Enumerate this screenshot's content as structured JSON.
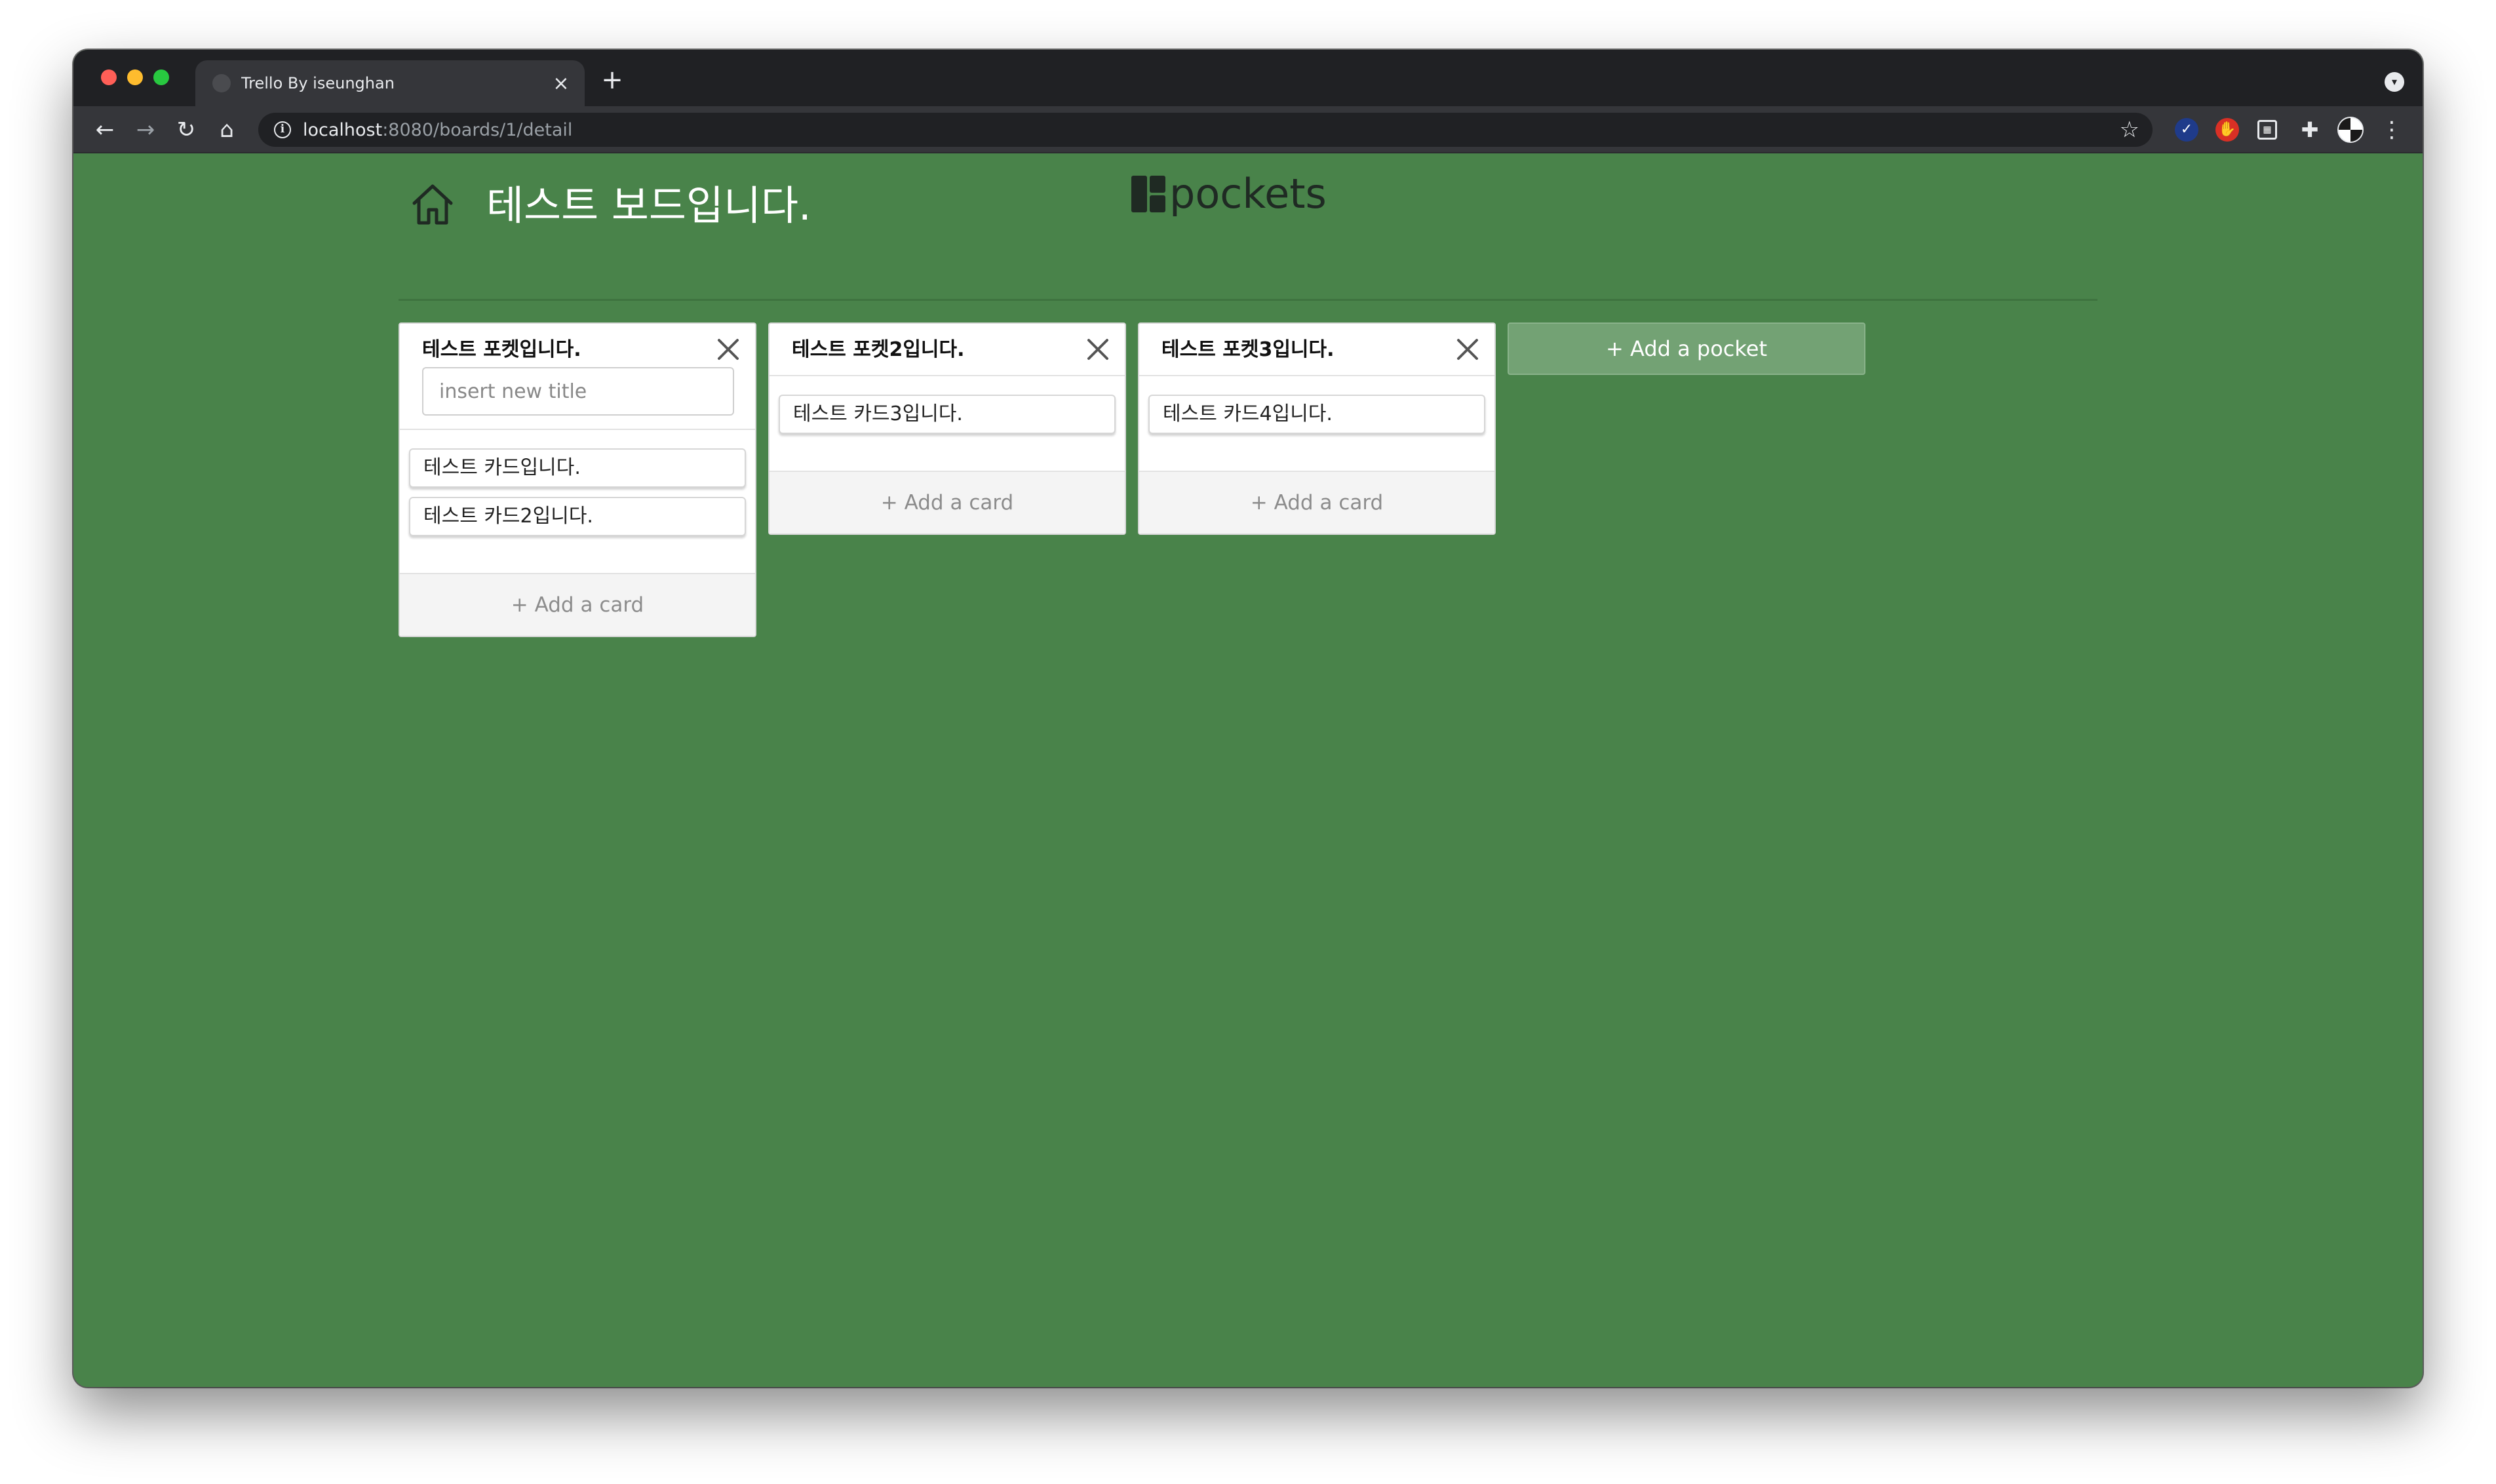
{
  "browser": {
    "tab_title": "Trello By iseunghan",
    "tab_close": "×",
    "new_tab": "+",
    "url_host": "localhost",
    "url_path": ":8080/boards/1/detail",
    "back": "←",
    "forward": "→",
    "reload": "↻",
    "home": "⌂",
    "star": "☆",
    "more": "⋮"
  },
  "header": {
    "board_title": "테스트 보드입니다.",
    "brand": "pockets"
  },
  "pockets": [
    {
      "title": "테스트 포켓입니다.",
      "input_placeholder": "insert new title",
      "cards": [
        "테스트 카드입니다.",
        "테스트 카드2입니다."
      ],
      "add_card": "+ Add a card"
    },
    {
      "title": "테스트 포켓2입니다.",
      "cards": [
        "테스트 카드3입니다."
      ],
      "add_card": "+ Add a card"
    },
    {
      "title": "테스트 포켓3입니다.",
      "cards": [
        "테스트 카드4입니다."
      ],
      "add_card": "+ Add a card"
    }
  ],
  "add_pocket": "+ Add a pocket",
  "colors": {
    "board_background": "#49834a",
    "add_pocket_background": "#73a274",
    "browser_chrome": "#202124"
  }
}
